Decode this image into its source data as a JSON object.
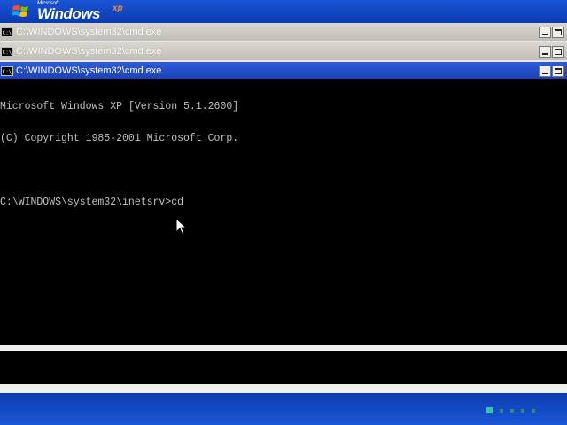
{
  "desktop": {
    "logo_microsoft": "Microsoft",
    "logo_windows": "Windows",
    "logo_xp": "xp",
    "colors": {
      "blue": "#0a3fb4",
      "progress_active": "#35c9a2"
    }
  },
  "windows": [
    {
      "title": "C:\\WINDOWS\\system32\\cmd.exe",
      "state": "inactive"
    },
    {
      "title": "C:\\WINDOWS\\system32\\cmd.exe",
      "state": "inactive"
    },
    {
      "title": "C:\\WINDOWS\\system32\\cmd.exe",
      "state": "active"
    }
  ],
  "console": {
    "lines": [
      "Microsoft Windows XP [Version 5.1.2600]",
      "(C) Copyright 1985-2001 Microsoft Corp.",
      "",
      "C:\\WINDOWS\\system32\\inetsrv>cd"
    ]
  },
  "icons": {
    "cmd": "cmd-window-icon",
    "minimize": "minimize-icon",
    "maximize": "maximize-icon",
    "pointer": "mouse-pointer-icon",
    "flag": "windows-flag-icon"
  }
}
